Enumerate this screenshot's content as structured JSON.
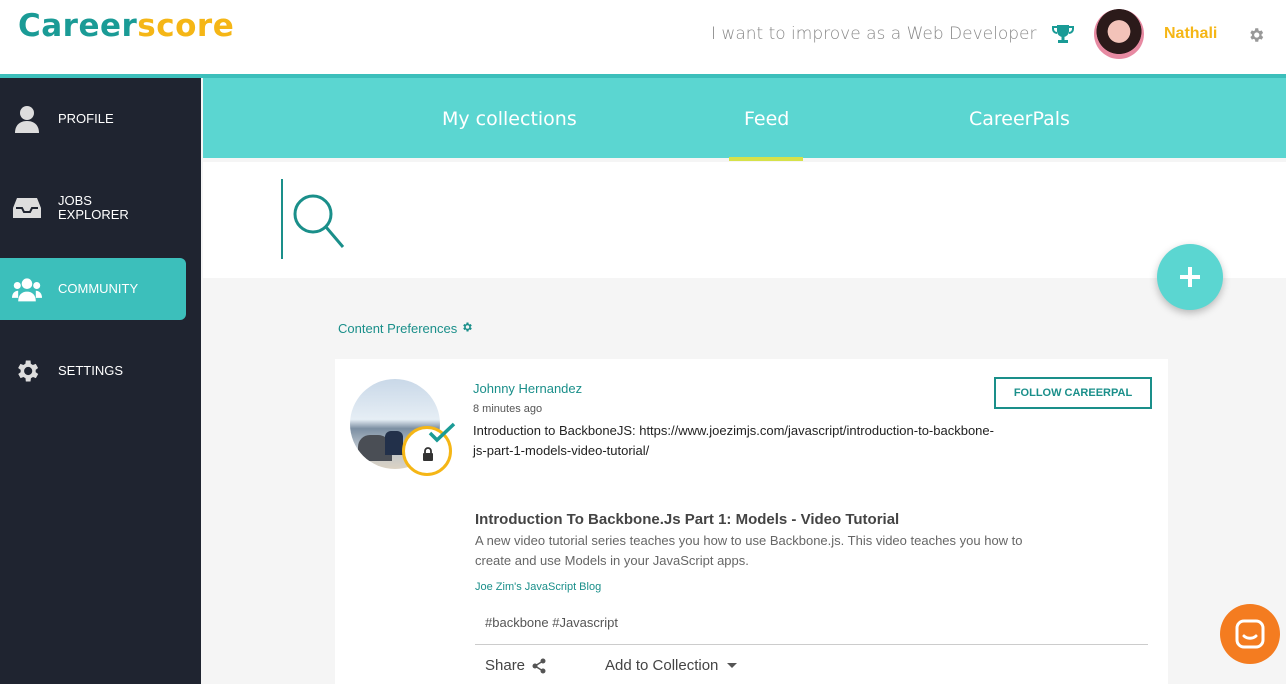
{
  "header": {
    "logo_part1": "Career",
    "logo_part2": "score",
    "goal": "I want to improve as a Web Developer",
    "user_name": "Nathali"
  },
  "sidebar": {
    "items": [
      {
        "label": "PROFILE",
        "icon": "user-icon"
      },
      {
        "label": "JOBS EXPLORER",
        "icon": "inbox-icon"
      },
      {
        "label": "COMMUNITY",
        "icon": "group-icon",
        "active": true
      },
      {
        "label": "SETTINGS",
        "icon": "gear-icon"
      }
    ]
  },
  "tabs": {
    "collections": "My collections",
    "feed": "Feed",
    "careerpals": "CareerPals"
  },
  "content_preferences": "Content Preferences",
  "post": {
    "author": "Johnny Hernandez",
    "time": "8 minutes ago",
    "text": "Introduction to BackboneJS: https://www.joezimjs.com/javascript/introduction-to-backbone-js-part-1-models-video-tutorial/",
    "follow_label": "FOLLOW CAREERPAL",
    "link_title": "Introduction To Backbone.Js Part 1: Models - Video Tutorial",
    "link_desc": "A new video tutorial series teaches you how to use Backbone.js. This video teaches you how to create and use Models in your JavaScript apps.",
    "link_source": "Joe Zim's JavaScript Blog",
    "tags": "#backbone #Javascript",
    "share_label": "Share",
    "add_collection_label": "Add to Collection"
  },
  "colors": {
    "teal": "#3cbfbb",
    "teal_light": "#5bd6d1",
    "yellow": "#f5b616",
    "sidebar_bg": "#1f2430",
    "chat_orange": "#f47c20"
  }
}
